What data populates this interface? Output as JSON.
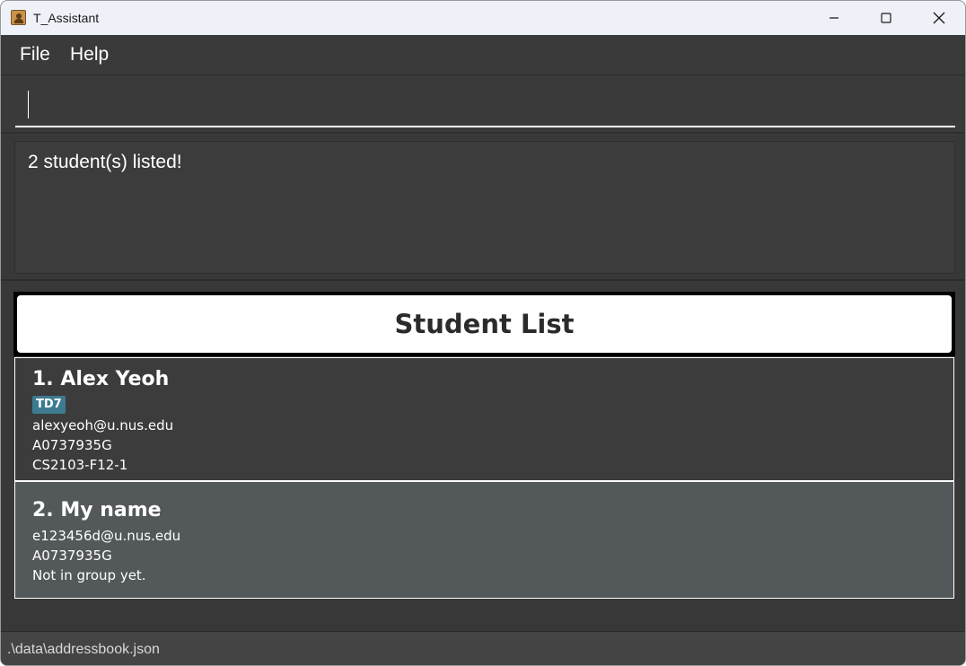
{
  "window": {
    "title": "T_Assistant",
    "icon": "address-book-icon"
  },
  "window_controls": {
    "minimize_icon": "minimize-icon",
    "maximize_icon": "maximize-icon",
    "close_icon": "close-icon"
  },
  "menu": {
    "items": [
      {
        "label": "File"
      },
      {
        "label": "Help"
      }
    ]
  },
  "command_box": {
    "value": "",
    "placeholder": ""
  },
  "result_display": {
    "text": "2 student(s) listed!"
  },
  "student_list": {
    "title": "Student List",
    "students": [
      {
        "index_name": "1. Alex Yeoh",
        "tag": "TD7",
        "email": "alexyeoh@u.nus.edu",
        "student_id": "A0737935G",
        "group": "CS2103-F12-1"
      },
      {
        "index_name": "2. My name",
        "tag": "",
        "email": "e123456d@u.nus.edu",
        "student_id": "A0737935G",
        "group": "Not in group yet."
      }
    ]
  },
  "status_bar": {
    "file_path": ".\\data\\addressbook.json"
  },
  "colors": {
    "background": "#3a3a3a",
    "selected_card": "#53585a",
    "tag": "#3e7b91",
    "title_bar": "#eef1f8"
  }
}
